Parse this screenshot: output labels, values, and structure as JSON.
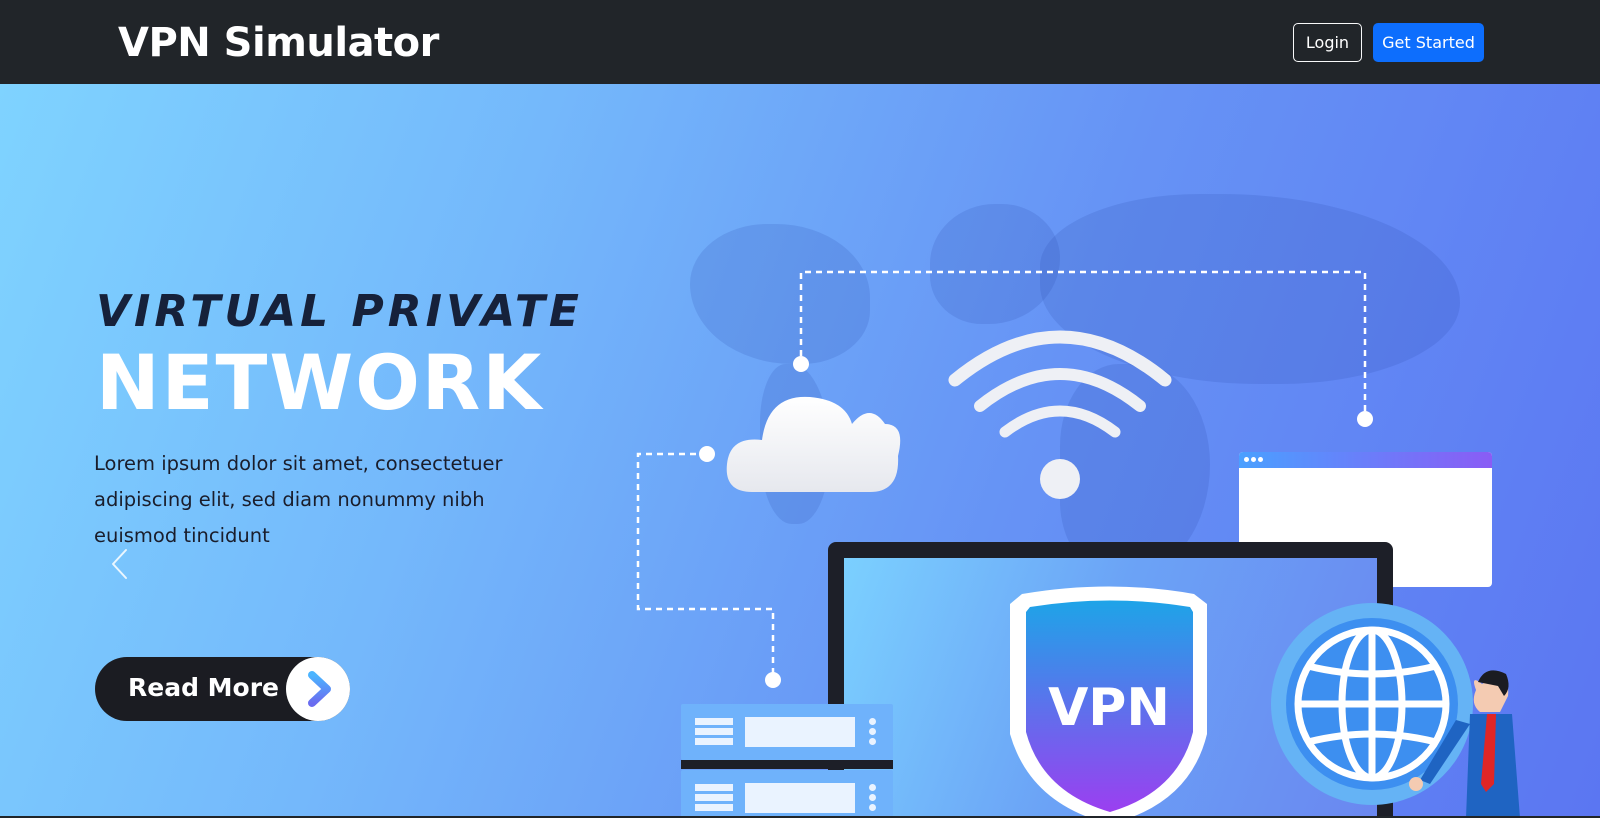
{
  "navbar": {
    "brand": "VPN Simulator",
    "login_label": "Login",
    "get_started_label": "Get Started"
  },
  "hero": {
    "title_line_1": "VIRTUAL PRIVATE",
    "title_line_2": "NETWORK",
    "body": "Lorem ipsum dolor sit amet, consectetuer adipiscing elit, sed diam nonummy nibh euismod tincidunt",
    "read_more_label": "Read More",
    "shield_text": "VPN"
  },
  "colors": {
    "navbar_bg": "#212529",
    "primary": "#0d6efd",
    "hero_gradient_start": "#7fd3ff",
    "hero_gradient_end": "#5b76f2"
  },
  "icons": {
    "prev": "chevron-left-icon",
    "read_more_arrow": "chevron-right-icon",
    "cloud": "cloud-icon",
    "wifi": "wifi-icon",
    "shield": "shield-icon",
    "globe": "globe-icon",
    "server": "server-icon",
    "browser": "browser-window-icon",
    "person": "person-icon"
  }
}
